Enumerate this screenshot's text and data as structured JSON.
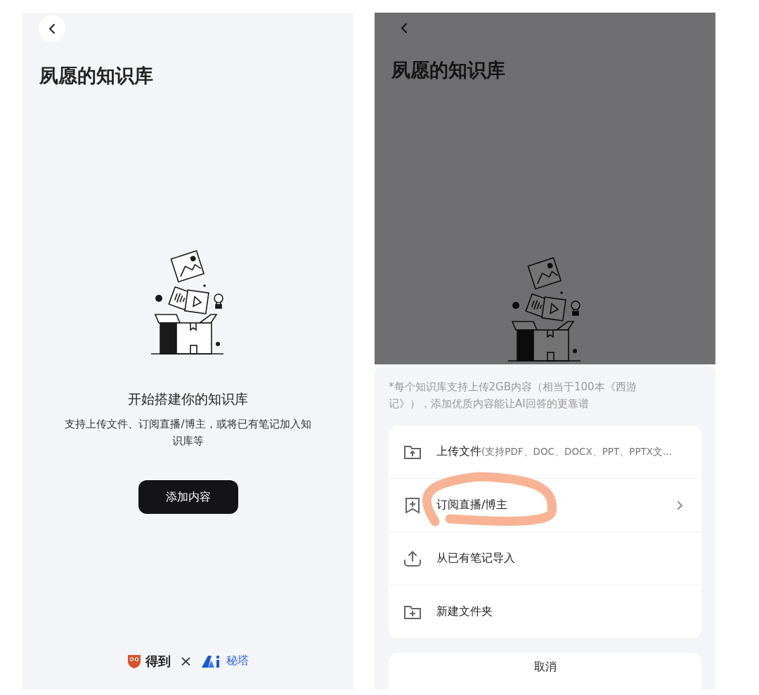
{
  "screens": [
    {
      "dimmed": false,
      "title": "夙愿的知识库",
      "empty_state": {
        "heading": "开始搭建你的知识库",
        "description": "支持上传文件、订阅直播/博主，或将已有笔记加入知识库等",
        "button": "添加内容"
      },
      "footer": {
        "brand_1": "得到",
        "separator": "×",
        "brand_2": "秘塔"
      }
    },
    {
      "dimmed": true,
      "title": "夙愿的知识库",
      "sheet": {
        "note": "*每个知识库支持上传2GB内容（相当于100本《西游记》），添加优质内容能让AI回答的更靠谱",
        "options": [
          {
            "kind": "upload",
            "label": "上传文件",
            "hint": "(支持PDF、DOC、DOCX、PPT、PPTX文…",
            "chevron": false,
            "annotated": false
          },
          {
            "kind": "subscribe",
            "label": "订阅直播/博主",
            "chevron": true,
            "annotated": true
          },
          {
            "kind": "import",
            "label": "从已有笔记导入",
            "chevron": false,
            "annotated": false
          },
          {
            "kind": "folder",
            "label": "新建文件夹",
            "chevron": false,
            "annotated": false
          }
        ],
        "cancel": "取消"
      }
    }
  ]
}
